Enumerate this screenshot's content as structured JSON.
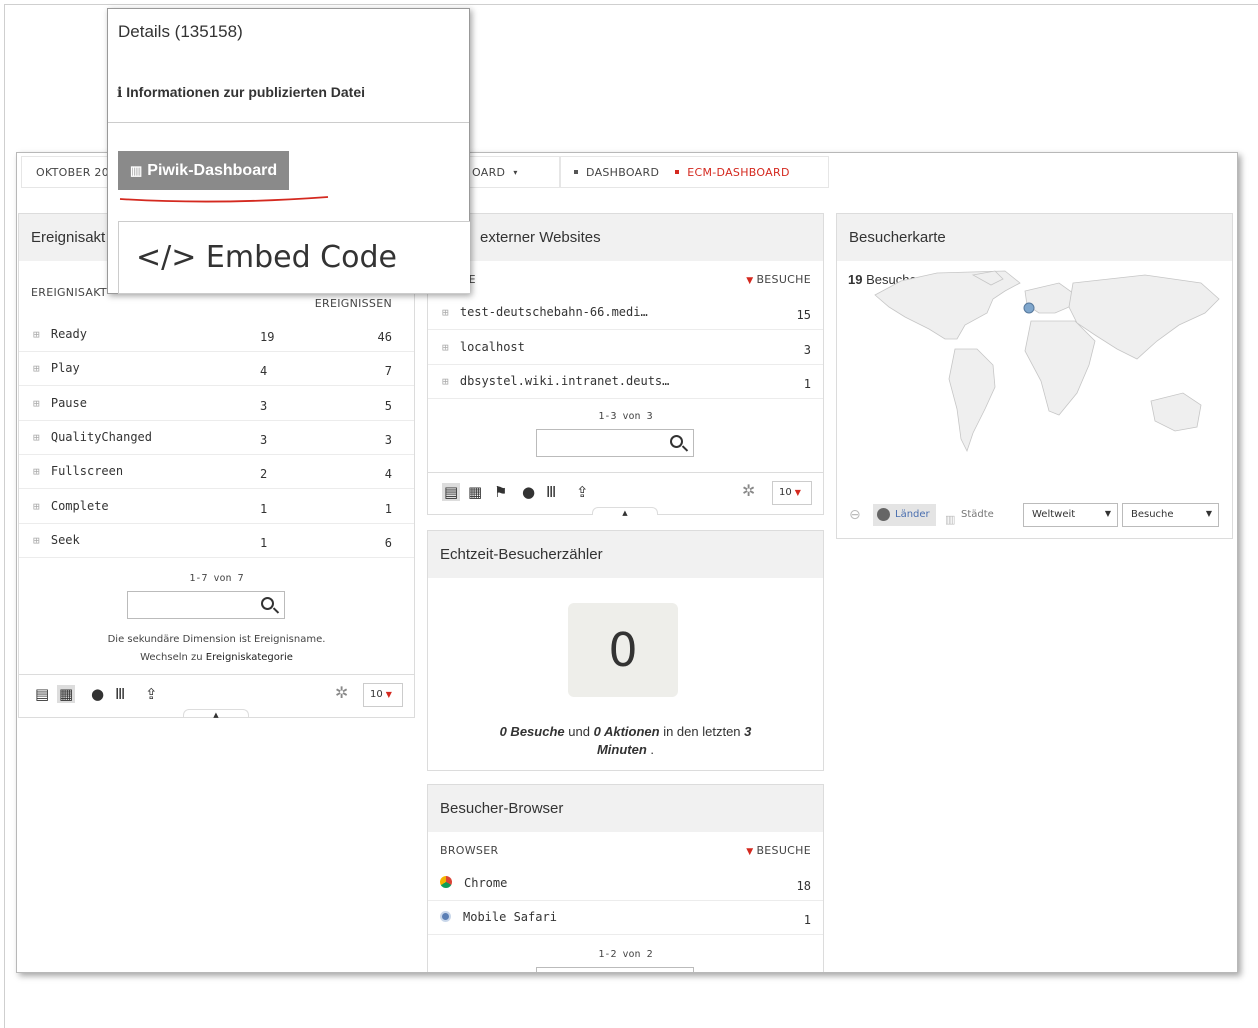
{
  "popup": {
    "title": "Details (135158)",
    "info_label": "Informationen zur publizierten Datei",
    "piwik_button": "Piwik-Dashboard",
    "embed_button": "</> Embed Code"
  },
  "topbar": {
    "date_label": "OKTOBER 20",
    "dashboard_menu": "OARD",
    "breadcrumb_dashboard": "DASHBOARD",
    "breadcrumb_ecm": "ECM-DASHBOARD"
  },
  "events_widget": {
    "title": "Ereignisakt",
    "col_label": "EREIGNISAKT",
    "col_events": "EREIGNISSEN",
    "rows": [
      {
        "label": "Ready",
        "v1": "19",
        "v2": "46"
      },
      {
        "label": "Play",
        "v1": "4",
        "v2": "7"
      },
      {
        "label": "Pause",
        "v1": "3",
        "v2": "5"
      },
      {
        "label": "QualityChanged",
        "v1": "3",
        "v2": "3"
      },
      {
        "label": "Fullscreen",
        "v1": "2",
        "v2": "4"
      },
      {
        "label": "Complete",
        "v1": "1",
        "v2": "1"
      },
      {
        "label": "Seek",
        "v1": "1",
        "v2": "6"
      }
    ],
    "pager": "1-7 von 7",
    "note_line1": "Die sekundäre Dimension ist Ereignisname.",
    "note_line2": "Wechseln zu",
    "note_link": "Ereigniskategorie",
    "limit": "10"
  },
  "websites_widget": {
    "title": "externer Websites",
    "col_label": "ITE",
    "col_visits": "BESUCHE",
    "rows": [
      {
        "label": "test-deutschebahn-66.medi…",
        "v": "15"
      },
      {
        "label": "localhost",
        "v": "3"
      },
      {
        "label": "dbsystel.wiki.intranet.deuts…",
        "v": "1"
      }
    ],
    "pager": "1-3 von 3",
    "limit": "10"
  },
  "map_widget": {
    "title": "Besucherkarte",
    "visits_count": "19",
    "visits_label": "Besuche",
    "btn_countries": "Länder",
    "btn_cities": "Städte",
    "select_region": "Weltweit",
    "select_metric": "Besuche"
  },
  "realtime_widget": {
    "title": "Echtzeit-Besucherzähler",
    "counter": "0",
    "visits_num": "0 Besuche",
    "and": "und",
    "actions_num": "0 Aktionen",
    "in_last": "in den letzten",
    "minutes_num": "3",
    "minutes_label": "Minuten",
    "period": "."
  },
  "browser_widget": {
    "title": "Besucher-Browser",
    "col_label": "BROWSER",
    "col_visits": "BESUCHE",
    "rows": [
      {
        "label": "Chrome",
        "v": "18"
      },
      {
        "label": "Mobile Safari",
        "v": "1"
      }
    ],
    "pager": "1-2 von 2"
  },
  "colors": {
    "accent_red": "#d4291f",
    "header_gray": "#f1f1f1",
    "button_gray": "#8a8a8a"
  }
}
